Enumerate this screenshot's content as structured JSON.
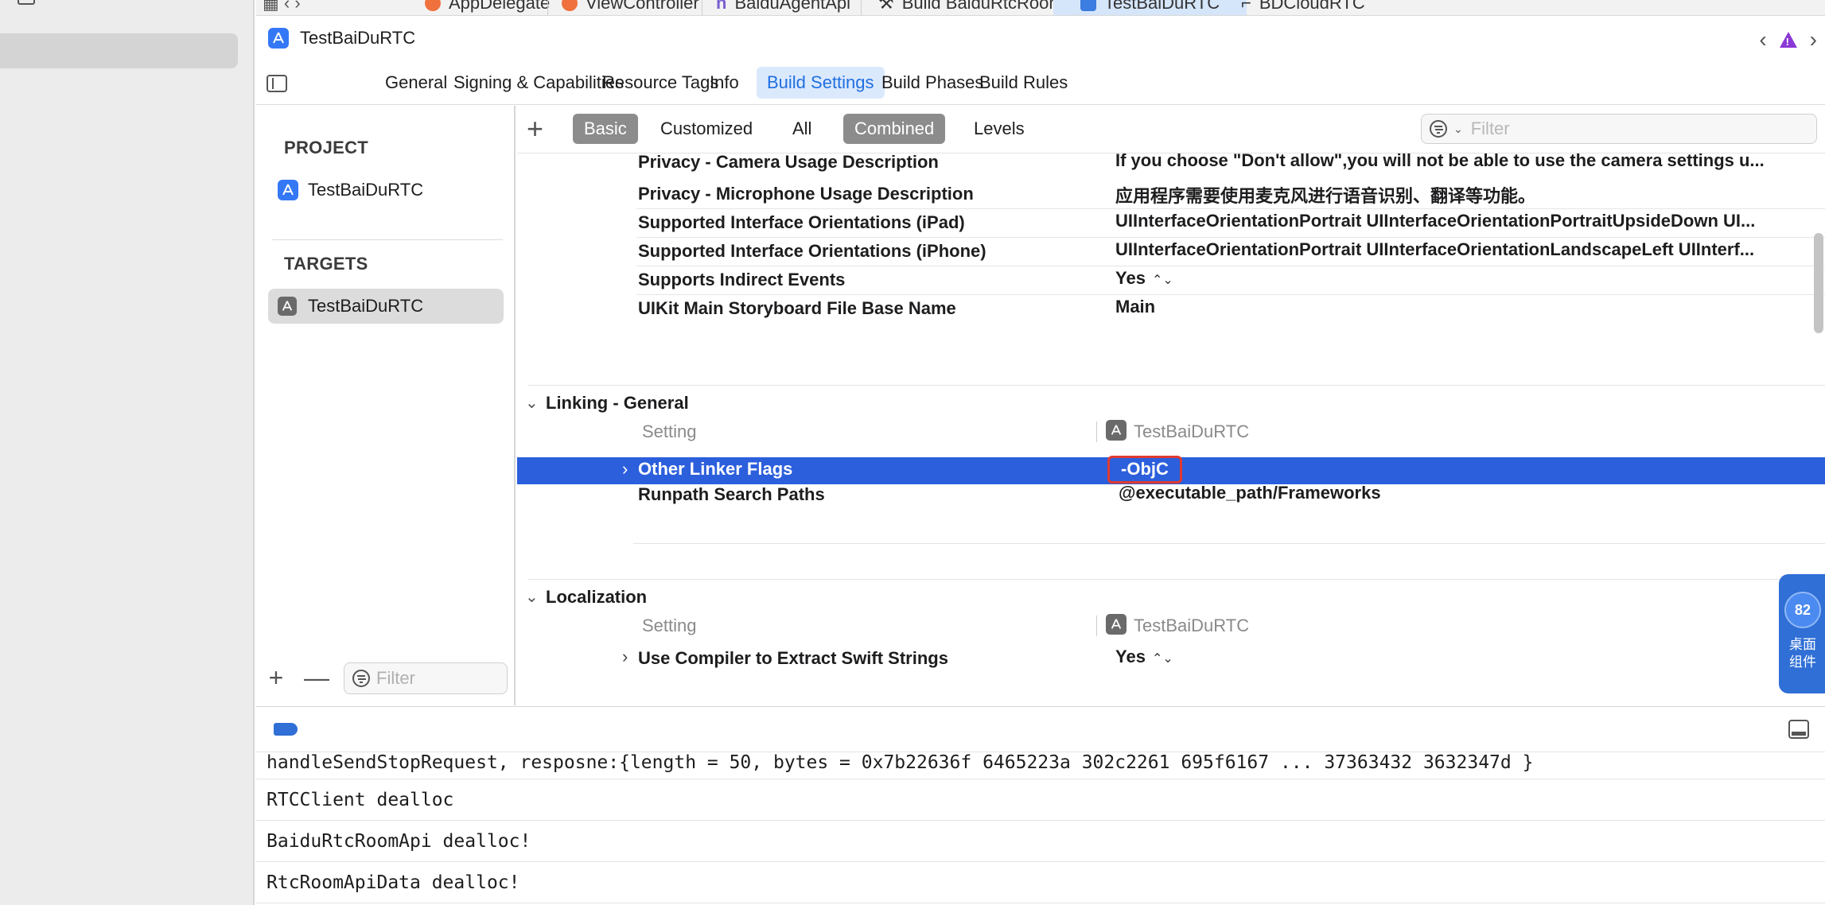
{
  "window": {
    "title": "TestBaiDuRTC"
  },
  "file_tabs": [
    {
      "label": "AppDelegate"
    },
    {
      "label": "ViewController"
    },
    {
      "label": "BaiduAgentApi"
    },
    {
      "label": "Build BaiduRtcRoom - Log"
    },
    {
      "label": "TestBaiDuRTC"
    },
    {
      "label": "BDCloudRTC"
    }
  ],
  "editor_tabs": [
    {
      "label": "General"
    },
    {
      "label": "Signing & Capabilities"
    },
    {
      "label": "Resource Tags"
    },
    {
      "label": "Info"
    },
    {
      "label": "Build Settings"
    },
    {
      "label": "Build Phases"
    },
    {
      "label": "Build Rules"
    }
  ],
  "navigator": {
    "project_header": "PROJECT",
    "project_item": "TestBaiDuRTC",
    "targets_header": "TARGETS",
    "target_item": "TestBaiDuRTC",
    "filter_placeholder": "Filter"
  },
  "toolbar": {
    "add_label": "+",
    "basic": "Basic",
    "customized": "Customized",
    "all": "All",
    "combined": "Combined",
    "levels": "Levels",
    "filter_placeholder": "Filter"
  },
  "info_rows": [
    {
      "name": "Privacy - Camera Usage Description",
      "value": "If you choose \"Don't allow\",you will not be able to use the camera settings u..."
    },
    {
      "name": "Privacy - Microphone Usage Description",
      "value": "应用程序需要使用麦克风进行语音识别、翻译等功能。"
    },
    {
      "name": "Supported Interface Orientations (iPad)",
      "value": "UIInterfaceOrientationPortrait UIInterfaceOrientationPortraitUpsideDown UI..."
    },
    {
      "name": "Supported Interface Orientations (iPhone)",
      "value": "UIInterfaceOrientationPortrait UIInterfaceOrientationLandscapeLeft UIInterf..."
    },
    {
      "name": "Supports Indirect Events",
      "value": "Yes"
    },
    {
      "name": "UIKit Main Storyboard File Base Name",
      "value": "Main"
    }
  ],
  "linking": {
    "title": "Linking - General",
    "setting_col": "Setting",
    "target_col": "TestBaiDuRTC",
    "other_linker_flags": {
      "name": "Other Linker Flags",
      "value": "-ObjC"
    },
    "runpath": {
      "name": "Runpath Search Paths",
      "value": "@executable_path/Frameworks"
    }
  },
  "localization": {
    "title": "Localization",
    "setting_col": "Setting",
    "target_col": "TestBaiDuRTC",
    "row": {
      "name": "Use Compiler to Extract Swift Strings",
      "value": "Yes"
    }
  },
  "widget": {
    "badge": "82",
    "label": "桌面组件"
  },
  "console": [
    "handleSendStopRequest, resposne:{length = 50, bytes = 0x7b22636f 6465223a 302c2261 695f6167 ... 37363432 3632347d }",
    "RTCClient dealloc",
    "BaiduRtcRoomApi dealloc!",
    "RtcRoomApiData dealloc!"
  ],
  "colors": {
    "selection": "#2c5fdc",
    "accent": "#1f6fe0",
    "highlight_box": "#e03a30",
    "warning": "#8a38d6"
  }
}
